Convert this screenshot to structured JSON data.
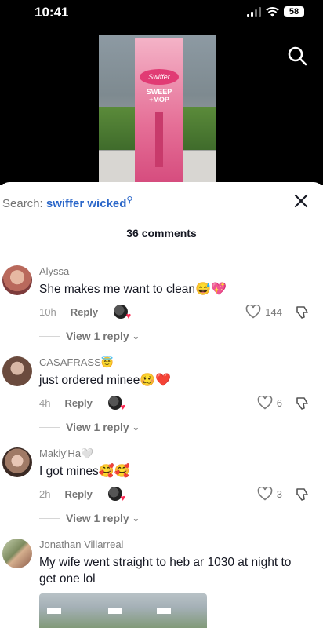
{
  "status_bar": {
    "time": "10:41",
    "battery": "58"
  },
  "video": {
    "box_logo": "Swiffer",
    "box_title": "SWEEP +MOP",
    "icons": {
      "search": "search-icon"
    }
  },
  "sheet": {
    "search_prefix": "Search:",
    "search_term": "swiffer wicked",
    "comment_count": "36 comments",
    "close_icon": "close-icon"
  },
  "comments": [
    {
      "username": "Alyssa",
      "text": "She makes me want to clean",
      "emojis": "😅💖",
      "time": "10h",
      "reply_label": "Reply",
      "likes": "144",
      "view_replies": "View 1 reply"
    },
    {
      "username": "CASAFRASS",
      "username_emoji": "😇",
      "text": "just ordered minee",
      "emojis": "🥴❤️",
      "time": "4h",
      "reply_label": "Reply",
      "likes": "6",
      "view_replies": "View 1 reply"
    },
    {
      "username": "Makiy'Ha",
      "username_emoji": "🤍",
      "text": "I got mines",
      "emojis": "🥰🥰",
      "time": "2h",
      "reply_label": "Reply",
      "likes": "3",
      "view_replies": "View 1 reply"
    },
    {
      "username": "Jonathan Villarreal",
      "text": "My wife went straight to heb ar 1030 at night to get one lol"
    }
  ],
  "colors": {
    "accent_blue": "#2a66c9",
    "heart_red": "#fe2c55",
    "text_dark": "#161823",
    "text_grey": "#7a7a7a"
  }
}
